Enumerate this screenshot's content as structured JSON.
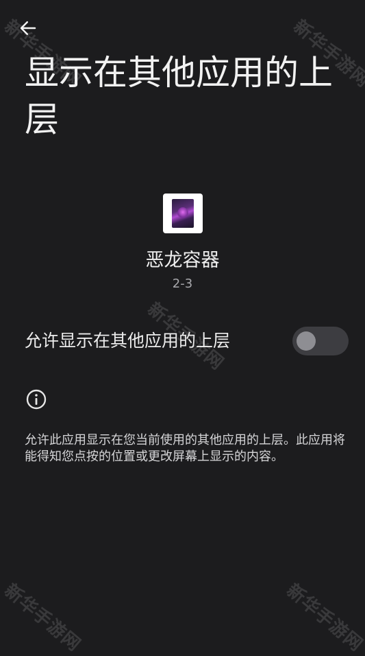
{
  "header": {
    "back_icon": "arrow-left-icon",
    "title": "显示在其他应用的上层"
  },
  "app": {
    "name": "恶龙容器",
    "version": "2-3"
  },
  "permission": {
    "label": "允许显示在其他应用的上层",
    "enabled": false
  },
  "info": {
    "icon": "info-icon",
    "description": "允许此应用显示在您当前使用的其他应用的上层。此应用将能得知您点按的位置或更改屏幕上显示的内容。"
  },
  "watermark": {
    "text": "新华手游网"
  },
  "colors": {
    "background": "#1c1c1e",
    "switch_track_off": "#3d3d41",
    "switch_thumb_off": "#8e8e93"
  }
}
